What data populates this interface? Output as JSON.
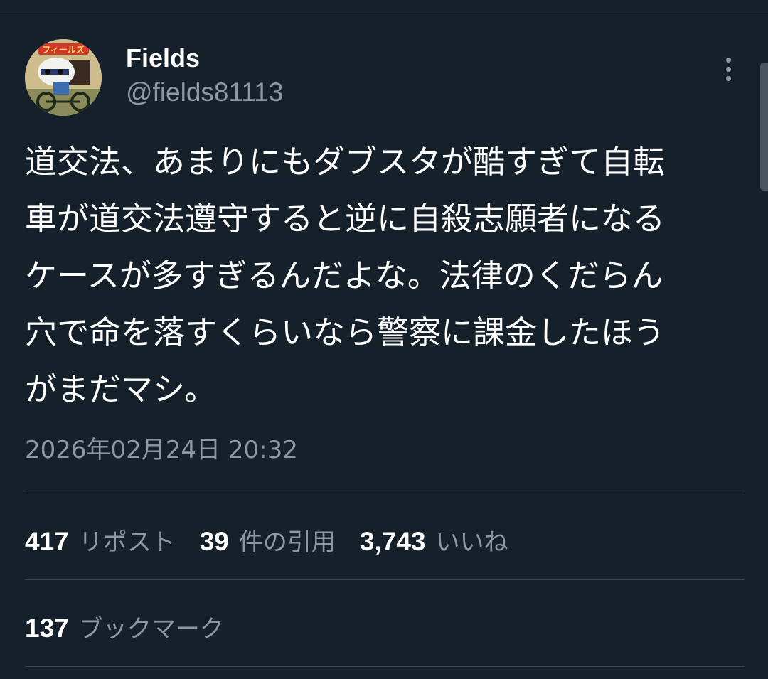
{
  "tweet": {
    "author": {
      "display_name": "Fields",
      "handle": "@fields81113",
      "avatar_text": "フィールズ"
    },
    "text_lines": [
      "道交法、あまりにもダブスタが酷すぎて自転",
      "車が道交法遵守すると逆に自殺志願者になる",
      "ケースが多すぎるんだよな。法律のくだらん",
      "穴で命を落すくらいなら警察に課金したほう",
      "がまだマシ。"
    ],
    "timestamp": "2026年02月24日 20:32"
  },
  "stats": {
    "reposts": {
      "count": "417",
      "label": "リポスト"
    },
    "quotes": {
      "count": "39",
      "label": "件の引用"
    },
    "likes": {
      "count": "3,743",
      "label": "いいね"
    },
    "bookmarks": {
      "count": "137",
      "label": "ブックマーク"
    }
  },
  "icons": {
    "more": "more-vertical-icon"
  },
  "colors": {
    "background": "#15202b",
    "primary_text": "#ffffff",
    "secondary_text": "#8b98a5",
    "divider": "#38444d"
  }
}
